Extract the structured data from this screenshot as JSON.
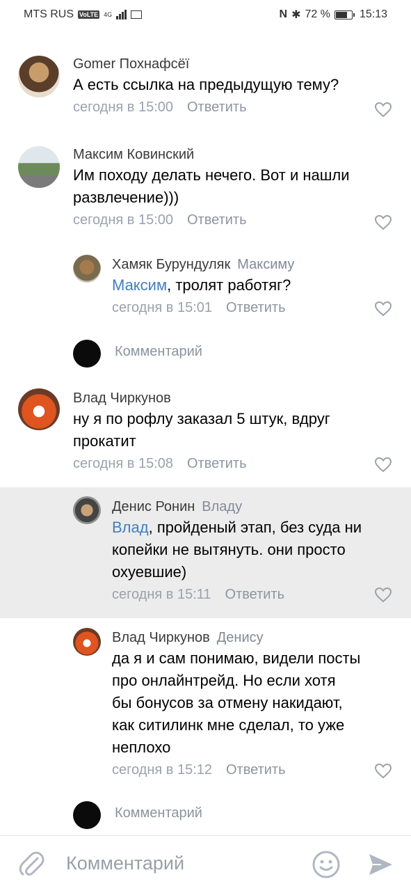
{
  "statusbar": {
    "carrier": "MTS RUS",
    "volte": "VoLTE",
    "network": "4G",
    "battery": "72 %",
    "time": "15:13"
  },
  "comments": [
    {
      "author": "Gomer Похнафсёї",
      "text": "А есть ссылка на предыдущую тему?",
      "time": "сегодня в 15:00",
      "reply": "Ответить"
    },
    {
      "author": "Максим Ковинский",
      "text_lines": [
        "Им походу делать нечего. Вот и нашли",
        "развлечение)))"
      ],
      "time": "сегодня в 15:00",
      "reply": "Ответить"
    },
    {
      "author": "Хамяк Бурундуляк",
      "reply_to": "Максиму",
      "mention": "Максим",
      "text": ", тролят работяг?",
      "time": "сегодня в 15:01",
      "reply": "Ответить"
    },
    {
      "author": "Влад Чиркунов",
      "text_lines": [
        "ну я по рофлу заказал 5 штук, вдруг",
        "прокатит"
      ],
      "time": "сегодня в 15:08",
      "reply": "Ответить"
    },
    {
      "author": "Денис Ронин",
      "reply_to": "Владу",
      "mention": "Влад",
      "text_first": ", пройденый этап, без суда ни",
      "text_lines": [
        "копейки не вытянуть. они просто",
        "охуевшие)"
      ],
      "time": "сегодня в 15:11",
      "reply": "Ответить"
    },
    {
      "author": "Влад Чиркунов",
      "reply_to": "Денису",
      "text_lines": [
        "да я и сам понимаю, видели посты",
        "про онлайнтрейд. Но если хотя",
        "бы бонусов за отмену накидают,",
        "как ситилинк мне сделал, то уже",
        "неплохо"
      ],
      "time": "сегодня в 15:12",
      "reply": "Ответить"
    }
  ],
  "compose_inline": {
    "placeholder": "Комментарий"
  },
  "bottom": {
    "placeholder": "Комментарий"
  },
  "colors": {
    "link": "#3f7ec2",
    "meta": "#99a2ad",
    "highlight": "#ececec"
  }
}
